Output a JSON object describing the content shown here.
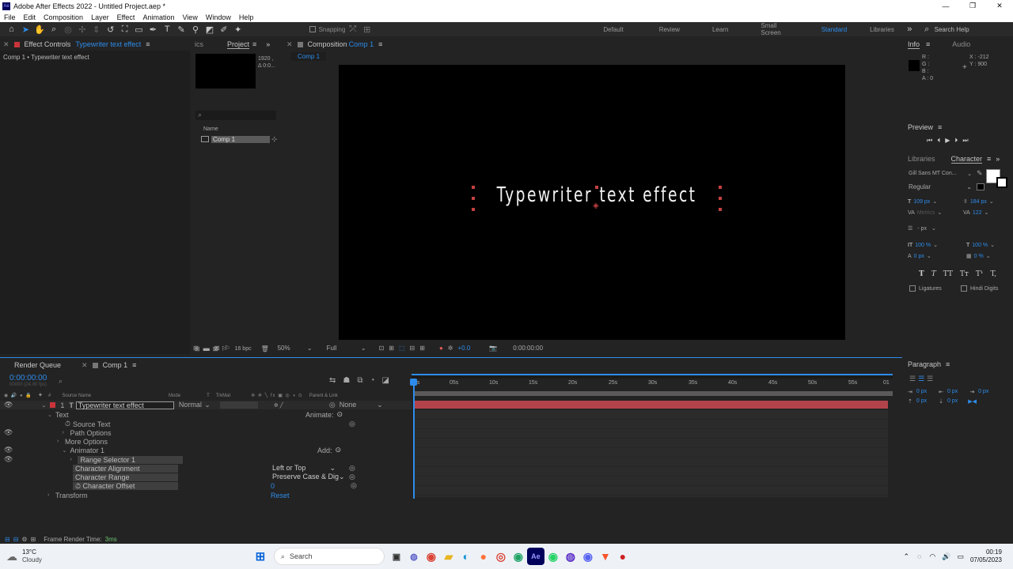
{
  "window": {
    "title": "Adobe After Effects 2022 - Untitled Project.aep *",
    "controls": [
      "—",
      "❐",
      "✕"
    ]
  },
  "menu": [
    "File",
    "Edit",
    "Composition",
    "Layer",
    "Effect",
    "Animation",
    "View",
    "Window",
    "Help"
  ],
  "toolbar": {
    "snapping": "Snapping",
    "workspaces": [
      "Default",
      "Review",
      "Learn",
      "Small Screen",
      "Standard",
      "Libraries"
    ],
    "active_workspace": "Standard",
    "search_placeholder": "Search Help"
  },
  "effect_controls": {
    "tab_label": "Effect Controls",
    "layer_name": "Typewriter text effect",
    "breadcrumb": "Comp 1 • Typewriter text effect",
    "partial_tab": "ics"
  },
  "project": {
    "tab": "Project",
    "thumb_info": [
      "1920 ,",
      "Δ 0:0..."
    ],
    "name_header": "Name",
    "items": [
      {
        "name": "Comp 1"
      }
    ],
    "bpc": "16 bpc"
  },
  "composition": {
    "tab_prefix": "Composition",
    "comp_name": "Comp 1",
    "sub_tab": "Comp 1",
    "text": "Typewriter text effect",
    "zoom": "50%",
    "resolution": "Full",
    "exposure": "+0.0",
    "timecode": "0:00:00:00"
  },
  "info": {
    "tab": "Info",
    "tab2": "Audio",
    "r": "R :",
    "g": "G :",
    "b": "B :",
    "a": "A : 0",
    "x": "X : -212",
    "y": "Y : 900"
  },
  "preview": {
    "title": "Preview"
  },
  "character": {
    "tab1": "Libraries",
    "tab2": "Character",
    "font": "Gill Sans MT Con...",
    "style": "Regular",
    "size": "109 px",
    "leading": "184 px",
    "kerning": "Metrics",
    "tracking": "122",
    "stroke": "- px",
    "vscale": "100 %",
    "hscale": "100 %",
    "baseline": "0 px",
    "tsume": "0 %",
    "ligatures": "Ligatures",
    "hindi": "Hindi Digits",
    "styles": [
      "T",
      "T",
      "TT",
      "Tт",
      "T¹",
      "T,"
    ]
  },
  "paragraph": {
    "title": "Paragraph",
    "indent1": "0 px",
    "indent2": "0 px",
    "indent3": "0 px",
    "space1": "0 px",
    "space2": "0 px"
  },
  "timeline": {
    "render_queue": "Render Queue",
    "comp_tab": "Comp 1",
    "timecode": "0:00:00:00",
    "fps": "00000 (24.00 fps)",
    "columns": {
      "source": "Source Name",
      "mode": "Mode",
      "t": "T",
      "trkmat": "TrkMat",
      "parent": "Parent & Link"
    },
    "layer": {
      "num": "1",
      "name": "Typewriter text effect",
      "mode": "Normal",
      "parent": "None"
    },
    "props": {
      "text": "Text",
      "animate": "Animate:",
      "source_text": "Source Text",
      "path_options": "Path Options",
      "more_options": "More Options",
      "animator": "Animator 1",
      "add": "Add:",
      "range_selector": "Range Selector 1",
      "char_alignment": "Character Alignment",
      "char_alignment_val": "Left or Top",
      "char_range": "Character Range",
      "char_range_val": "Preserve Case & Dig",
      "char_offset": "Character Offset",
      "char_offset_val": "0",
      "reset": "Reset",
      "transform": "Transform"
    },
    "ruler": [
      "0s",
      "05s",
      "10s",
      "15s",
      "20s",
      "25s",
      "30s",
      "35s",
      "40s",
      "45s",
      "50s",
      "55s",
      "01"
    ],
    "frame_render": "Frame Render Time:",
    "frame_render_val": "3ms"
  },
  "taskbar": {
    "temp": "13°C",
    "weather": "Cloudy",
    "search": "Search",
    "time": "00:19",
    "date": "07/05/2023"
  }
}
